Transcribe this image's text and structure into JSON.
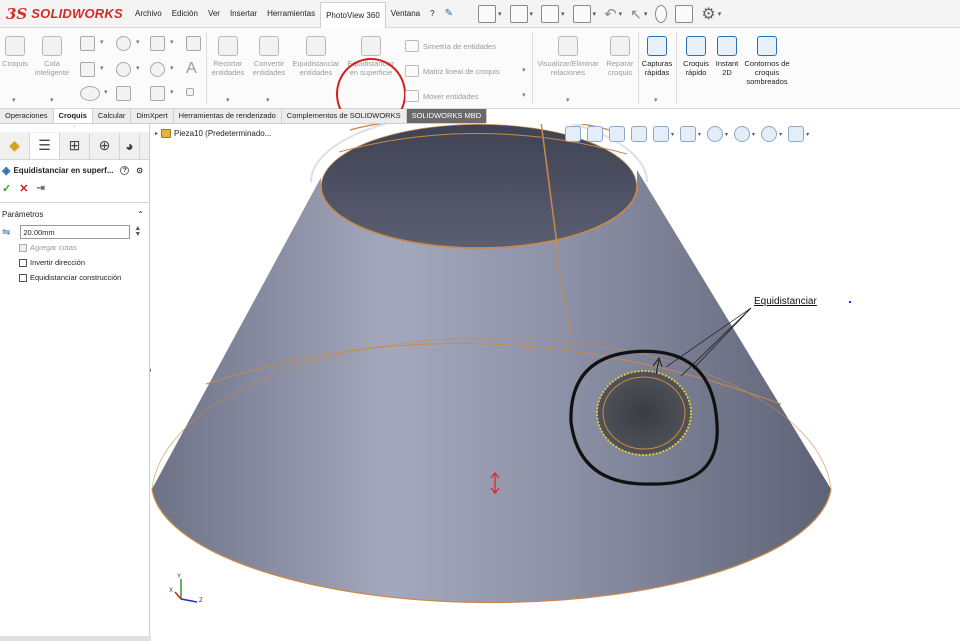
{
  "app": {
    "logo_prefix": "3S",
    "logo_text": "SOLIDWORKS"
  },
  "menu": [
    {
      "label": "Archivo"
    },
    {
      "label": "Edición"
    },
    {
      "label": "Ver"
    },
    {
      "label": "Insertar"
    },
    {
      "label": "Herramientas"
    },
    {
      "label": "PhotoView 360",
      "active": true
    },
    {
      "label": "Ventana"
    },
    {
      "label": "?"
    }
  ],
  "ribbon": {
    "croquis": "Croquis",
    "cota_inteligente": "Cota inteligente",
    "recortar_entidades": "Recortar entidades",
    "convertir_entidades": "Convertir entidades",
    "equidistanciar_entidades": "Equidistanciar entidades",
    "equidistanciar_superficie": "Equidistanciar en superficie",
    "simetria_entidades": "Simetría de entidades",
    "matriz_lineal": "Matriz lineal de croquis",
    "mover_entidades": "Mover entidades",
    "visualizar_eliminar": "Visualizar/Eliminar relaciones",
    "reparar_croquis": "Reparar croquis",
    "capturas_rapidas": "Capturas rápidas",
    "croquis_rapido": "Croquis rápido",
    "instant_2d": "Instant 2D",
    "contornos_sombreados": "Contornos de croquis sombreados",
    "annotation_mark": "?"
  },
  "tabs": [
    {
      "label": "Operaciones"
    },
    {
      "label": "Croquis",
      "active": true
    },
    {
      "label": "Calcular"
    },
    {
      "label": "DimXpert"
    },
    {
      "label": "Herramientas de renderizado"
    },
    {
      "label": "Complementos de SOLIDWORKS"
    },
    {
      "label": "SOLIDWORKS MBD",
      "dark": true
    }
  ],
  "property_manager": {
    "title": "Equidistanciar en superf...",
    "help": "?",
    "section_parametros": "Parámetros",
    "offset_value": "20.00mm",
    "agregar_cotas": "Agregar cotas",
    "invertir_direccion": "Invertir dirección",
    "equidistanciar_construccion": "Equidistanciar construcción"
  },
  "viewport": {
    "tree_root": "Pieza10  (Predeterminado...",
    "callout_label": "Equidistanciar",
    "triad": {
      "x": "X",
      "y": "Y",
      "z": "Z"
    }
  },
  "colors": {
    "annotation_red": "#d11f1f",
    "part_body": "#8e92a8",
    "edge_orange": "#c98a4a",
    "offset_black": "#111111",
    "selection_yellow": "#e8cf3a"
  }
}
